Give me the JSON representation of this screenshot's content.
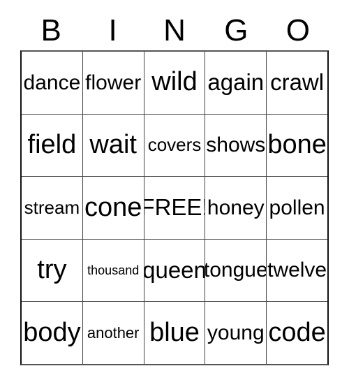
{
  "card": {
    "headers": [
      "B",
      "I",
      "N",
      "G",
      "O"
    ],
    "rows": [
      [
        {
          "text": "dance",
          "size": "lg"
        },
        {
          "text": "flower",
          "size": "lg"
        },
        {
          "text": "wild",
          "size": "xxl"
        },
        {
          "text": "again",
          "size": "xl"
        },
        {
          "text": "crawl",
          "size": "xl"
        }
      ],
      [
        {
          "text": "field",
          "size": "xxl"
        },
        {
          "text": "wait",
          "size": "xxl"
        },
        {
          "text": "covers",
          "size": "md"
        },
        {
          "text": "shows",
          "size": "lg"
        },
        {
          "text": "bone",
          "size": "xxl"
        }
      ],
      [
        {
          "text": "stream",
          "size": "md"
        },
        {
          "text": "cone",
          "size": "xxl"
        },
        {
          "text": "FREE!",
          "size": "xl"
        },
        {
          "text": "honey",
          "size": "lg"
        },
        {
          "text": "pollen",
          "size": "lg"
        }
      ],
      [
        {
          "text": "try",
          "size": "xxl"
        },
        {
          "text": "thousand",
          "size": "xs"
        },
        {
          "text": "queen",
          "size": "xl"
        },
        {
          "text": "tongue",
          "size": "lg"
        },
        {
          "text": "twelve",
          "size": "lg"
        }
      ],
      [
        {
          "text": "body",
          "size": "xxl"
        },
        {
          "text": "another",
          "size": "sm"
        },
        {
          "text": "blue",
          "size": "xxl"
        },
        {
          "text": "young",
          "size": "lg"
        },
        {
          "text": "code",
          "size": "xxl"
        }
      ]
    ],
    "free_space": "FREE!",
    "colors": {
      "text": "#000000",
      "grid_line": "#444444",
      "background": "#ffffff"
    }
  }
}
